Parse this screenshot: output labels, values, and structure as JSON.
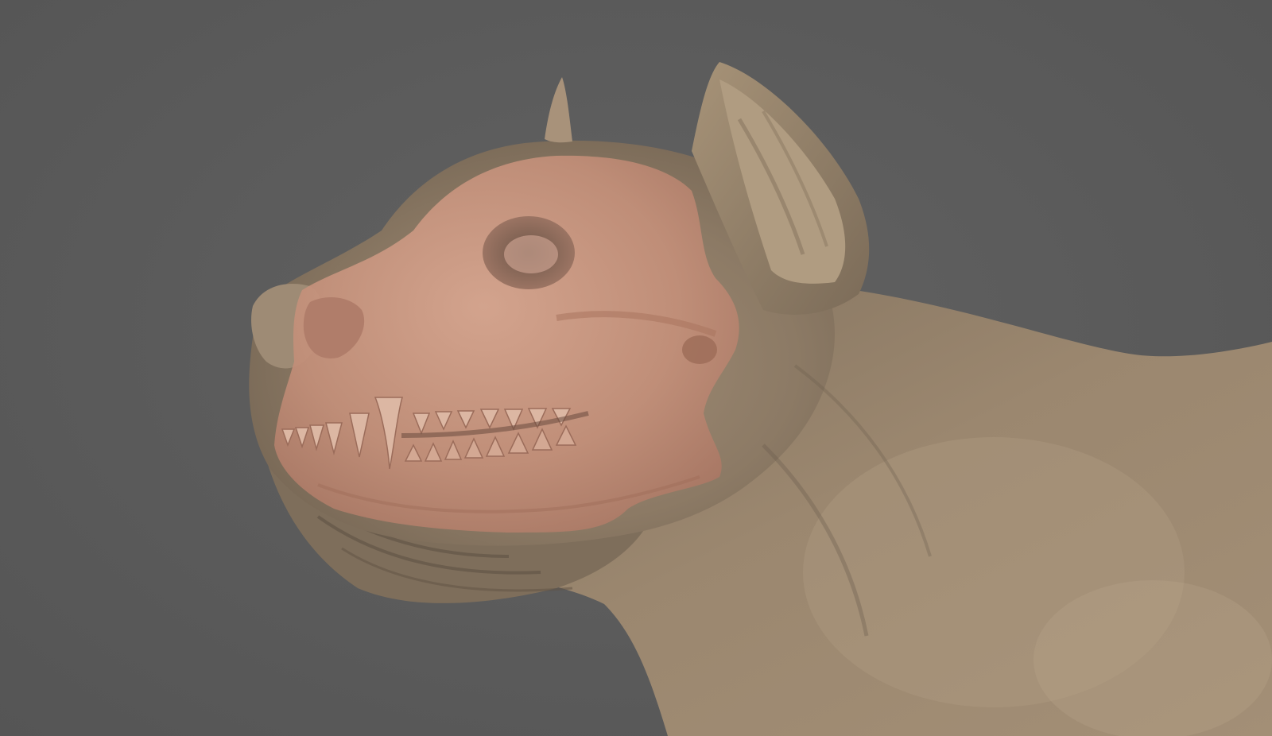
{
  "viewport": {
    "background_color": "#5c5c5c"
  },
  "model": {
    "subject": "dog-sculpt",
    "skin_color": "#8e7c67",
    "skull_overlay_color": "#c79580",
    "skull_overlay_opacity": 0.9
  }
}
